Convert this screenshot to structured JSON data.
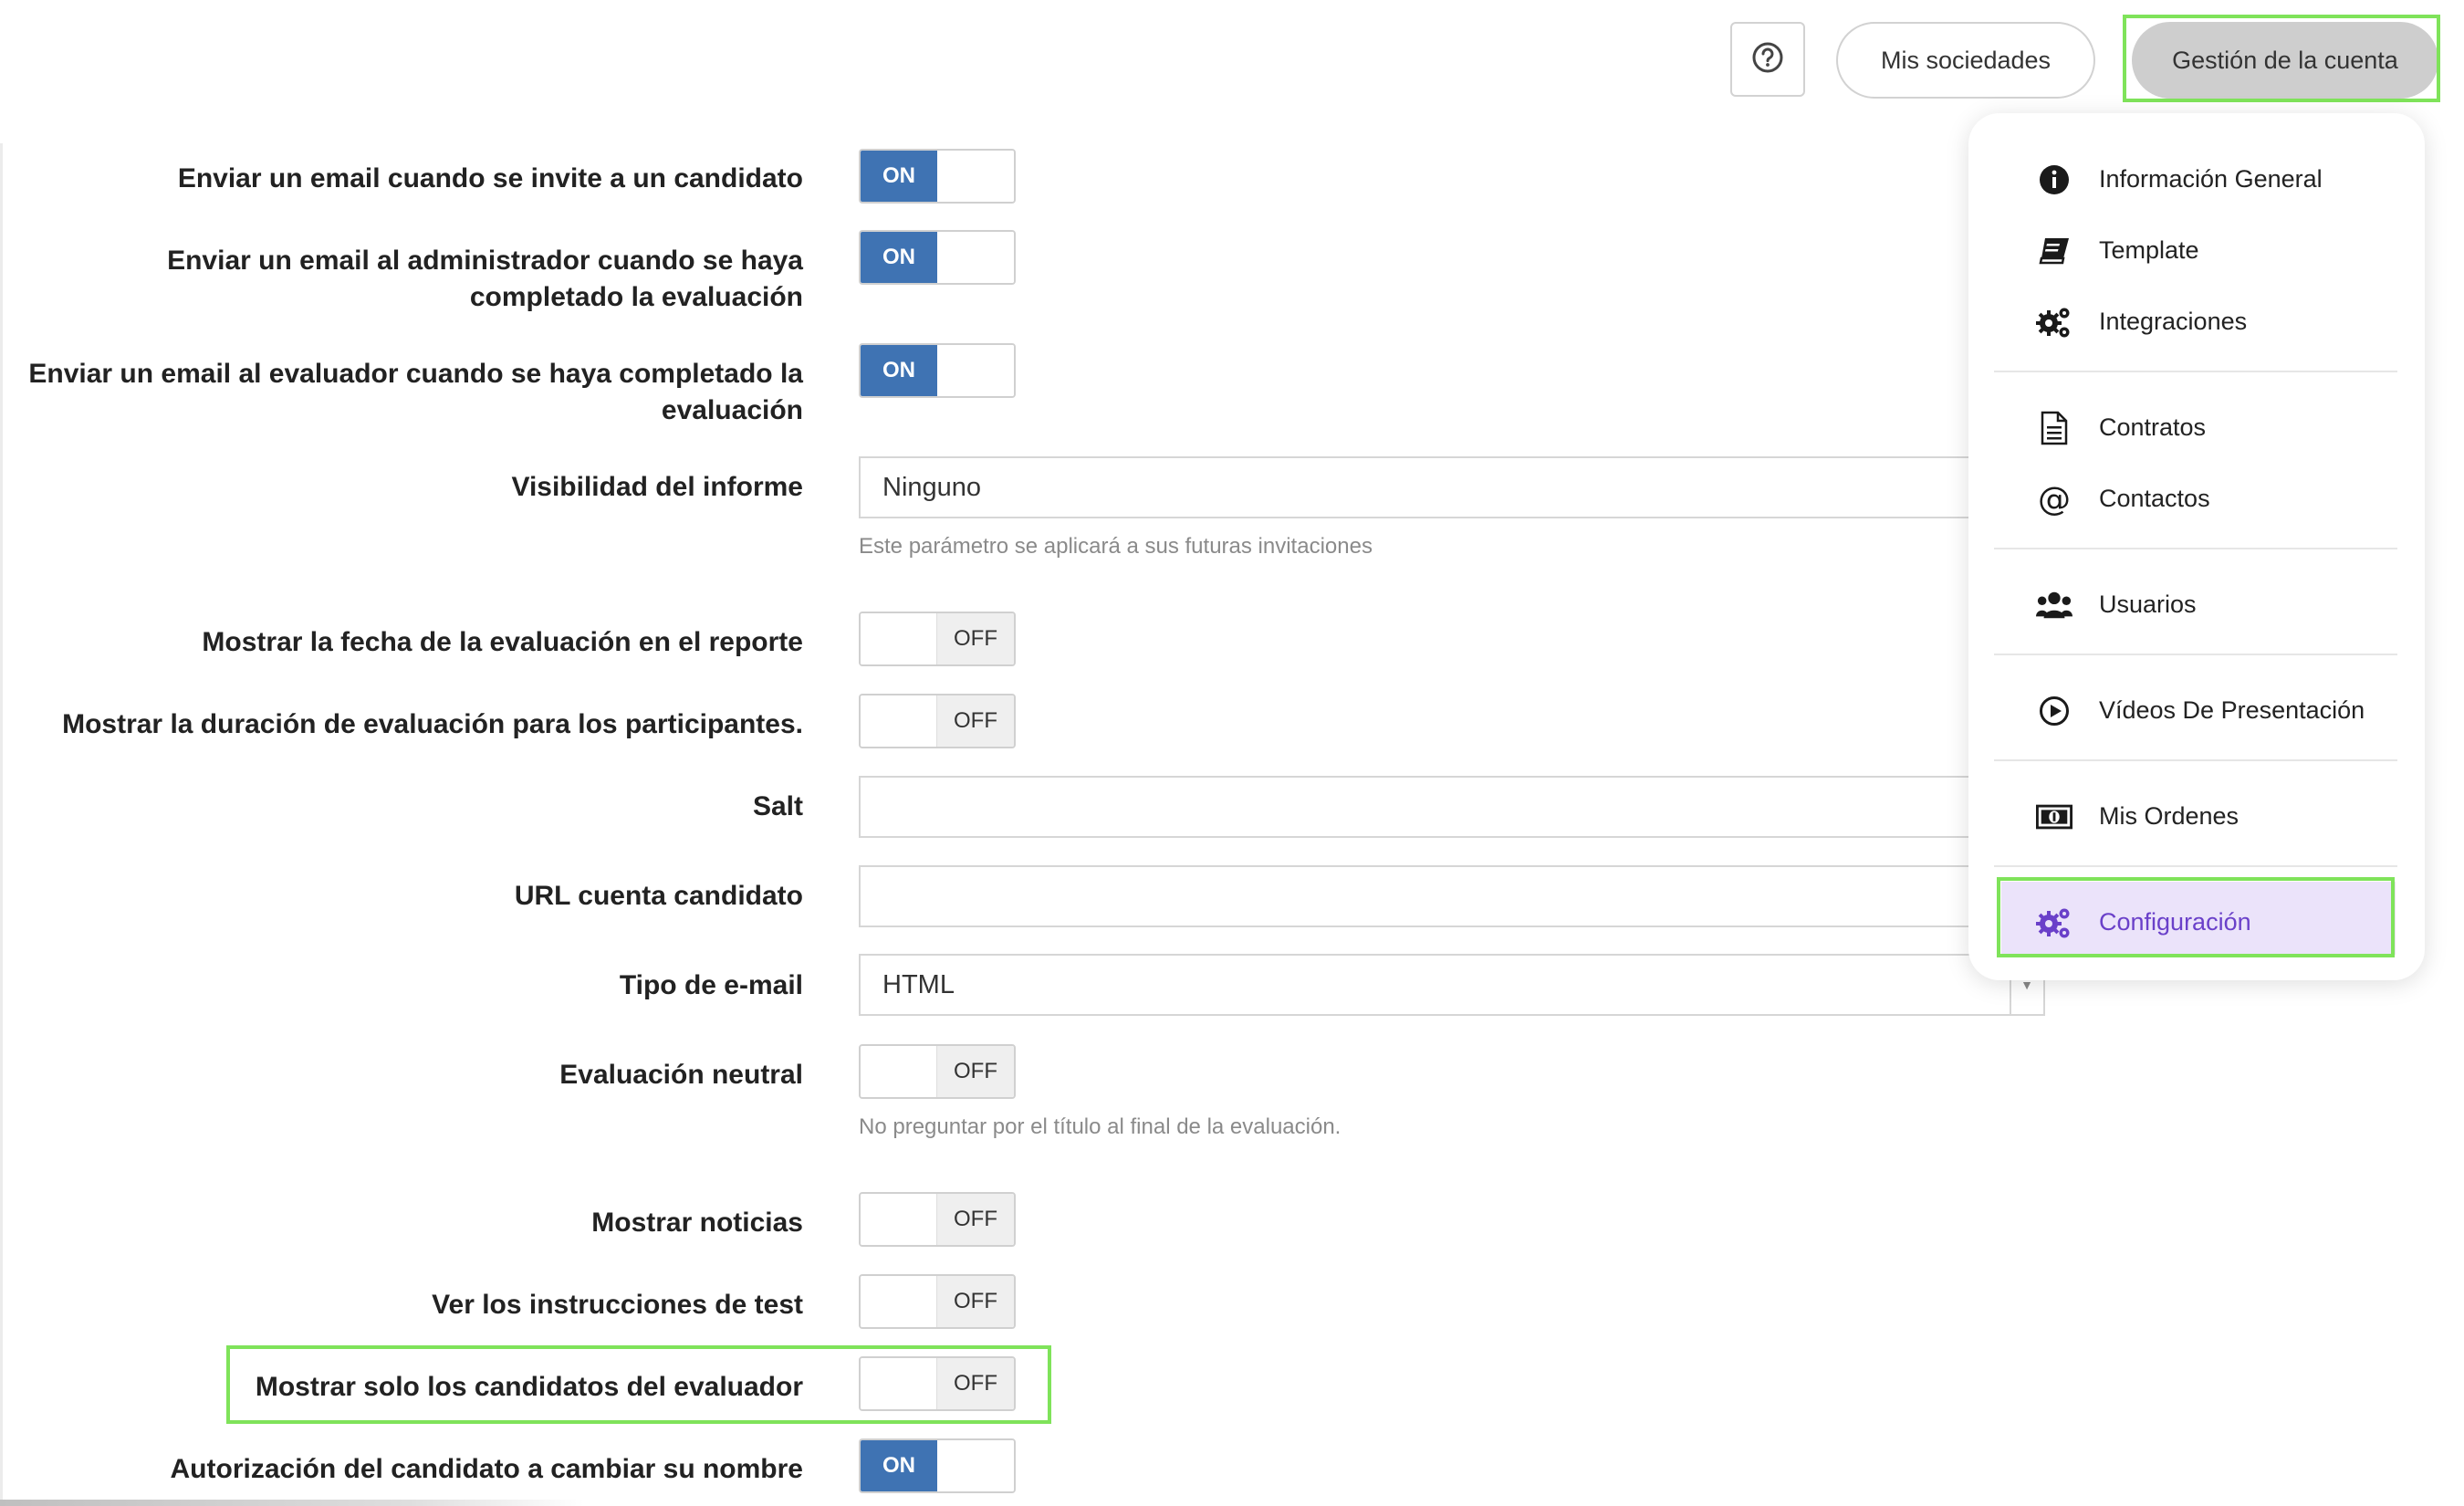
{
  "header": {
    "help_icon": "question-circle-icon",
    "societies_label": "Mis sociedades",
    "account_label": "Gestión de la cuenta"
  },
  "settings": [
    {
      "label": "Enviar un email cuando se invite a un candidato",
      "state": "ON"
    },
    {
      "label": "Enviar un email al administrador cuando se haya completado la evaluación",
      "state": "ON"
    },
    {
      "label": "Enviar un email al evaluador cuando se haya completado la evaluación",
      "state": "ON"
    },
    {
      "label": "Visibilidad del informe",
      "value": "Ninguno",
      "help": "Este parámetro se aplicará a sus futuras invitaciones"
    },
    {
      "label": "Mostrar la fecha de la evaluación en el reporte",
      "state": "OFF"
    },
    {
      "label": "Mostrar la duración de evaluación para los participantes.",
      "state": "OFF"
    },
    {
      "label": "Salt",
      "value": ""
    },
    {
      "label": "URL cuenta candidato",
      "value": ""
    },
    {
      "label": "Tipo de e-mail",
      "value": "HTML"
    },
    {
      "label": "Evaluación neutral",
      "state": "OFF",
      "help": "No preguntar por el título al final de la evaluación."
    },
    {
      "label": "Mostrar noticias",
      "state": "OFF"
    },
    {
      "label": "Ver los instrucciones de test",
      "state": "OFF"
    },
    {
      "label": "Mostrar solo los candidatos del evaluador",
      "state": "OFF"
    },
    {
      "label": "Autorización del candidato a cambiar su nombre",
      "state": "ON"
    }
  ],
  "menu": {
    "items": [
      {
        "label": "Información General",
        "icon": "info-circle-icon"
      },
      {
        "label": "Template",
        "icon": "book-icon"
      },
      {
        "label": "Integraciones",
        "icon": "gears-icon"
      },
      {
        "label": "Contratos",
        "icon": "document-icon"
      },
      {
        "label": "Contactos",
        "icon": "at-sign-icon"
      },
      {
        "label": "Usuarios",
        "icon": "users-icon"
      },
      {
        "label": "Vídeos De Presentación",
        "icon": "play-circle-icon"
      },
      {
        "label": "Mis Ordenes",
        "icon": "money-bill-icon"
      },
      {
        "label": "Configuración",
        "icon": "gears-icon",
        "active": true
      }
    ]
  },
  "colors": {
    "toggle_on": "#3f73b3",
    "highlight": "#7fe35a",
    "menu_active_text": "#6a40c9",
    "menu_active_bg": "#ebe3fa"
  }
}
